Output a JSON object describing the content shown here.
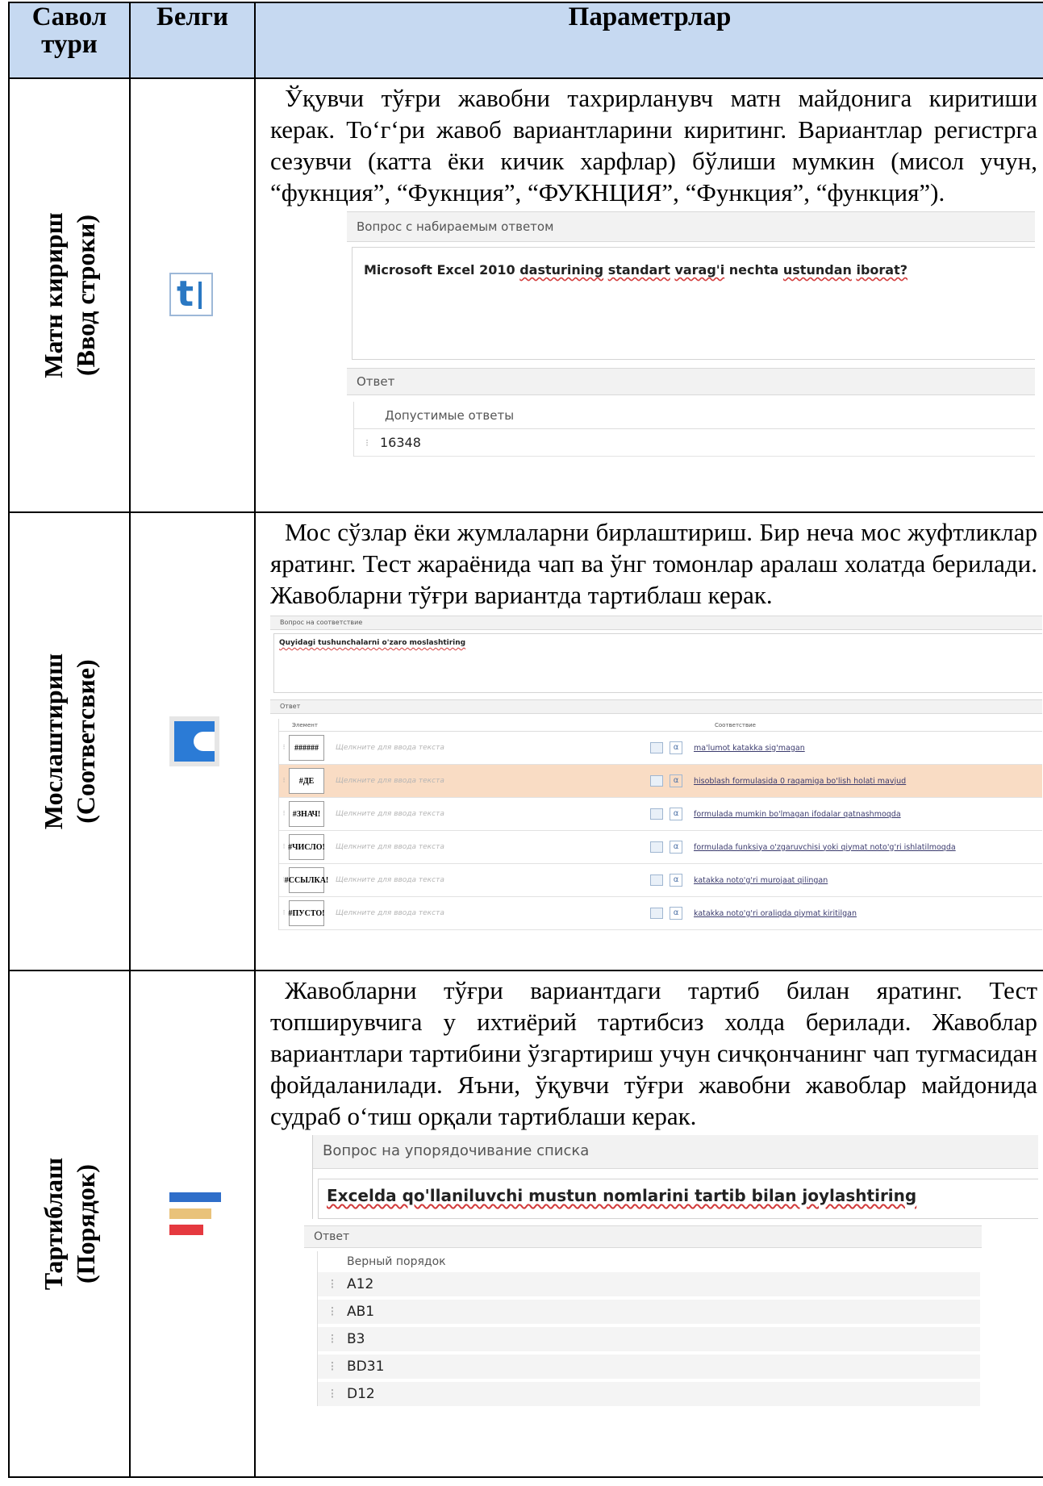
{
  "header": {
    "col1": "Савол тури",
    "col2": "Белги",
    "col3": "Параметрлар"
  },
  "rows": [
    {
      "type_main": "Матн кирирш",
      "type_sub": "(Ввод строки)",
      "icon": "text-input-icon",
      "description": "Ўқувчи тўғри жавобни тахрирланувч матн майдонига киритиши керак. То‘г‘ри жавоб вариантларини киритинг. Вариантлар регистрга сезувчи (катта ёки кичик харфлар) бўлиши мумкин (мисол учун, “фукнция”, “Фукнция”, “ФУКНЦИЯ”, “Функция”, “функция”).",
      "screenshot": {
        "panel_title": "Вопрос с набираемым ответом",
        "question_prefix": "Microsoft Excel 2010 ",
        "question_w1": "dasturining",
        "question_w2": "standart",
        "question_w3": "varag'i",
        "question_mid": " nechta ",
        "question_w4": "ustundan",
        "question_w5": "iborat?",
        "answer_title": "Ответ",
        "column_header": "Допустимые ответы",
        "answer_value": "16348"
      }
    },
    {
      "type_main": "Мослаштириш",
      "type_sub": "(Соответсвие)",
      "icon": "matching-icon",
      "description": "Мос сўзлар ёки жумлаларни бирлаштириш. Бир неча мос жуфтликлар яратинг. Тест жараёнида чап ва ўнг томонлар аралаш холатда берилади. Жавобларни тўғри вариантда тартиблаш керак.",
      "screenshot": {
        "panel_title": "Вопрос на соответствие",
        "question": "Quyidagi tushunchalarni o'zaro moslashtiring",
        "answer_title": "Ответ",
        "col_element": "Элемент",
        "col_match": "Соответствие",
        "placeholder": "Щелкните для ввода текста",
        "alpha_glyph": "α",
        "pairs": [
          {
            "element": "######",
            "answer": "ma'lumot katakka sig'magan"
          },
          {
            "element": "#ДЕ",
            "answer": "hisoblash formulasida 0 raqamiga bo'lish holati mavjud"
          },
          {
            "element": "#ЗНАЧ!",
            "answer": "formulada  mumkin bo'lmagan ifodalar qatnashmoqda"
          },
          {
            "element": "#ЧИСЛО!",
            "answer": "formulada funksiya o'zgaruvchisi yoki qiymat noto'g'ri ishlatilmoqda"
          },
          {
            "element": "#ССЫЛКА!",
            "answer": "katakka noto'g'ri murojaat qilingan"
          },
          {
            "element": "#ПУСТО!",
            "answer": "katakka noto'g'ri oraliqda qiymat kiritilgan"
          }
        ]
      }
    },
    {
      "type_main": "Тартиблаш",
      "type_sub": "(Порядок)",
      "icon": "ordering-icon",
      "description": "Жавобларни тўғри вариантдаги тартиб билан яратинг. Тест топширувчига у ихтиёрий тартибсиз холда берилади. Жавоблар вариантлари тартибини ўзгартириш учун сичқончанинг чап тугмасидан фойдаланилади. Яъни, ўқувчи тўғри жавобни жавоблар майдонида судраб о‘тиш орқали тартиблаши керак.",
      "screenshot": {
        "panel_title": "Вопрос на упорядочивание списка",
        "question": "Excelda qo'llaniluvchi mustun nomlarini tartib bilan joylashtiring",
        "answer_title": "Ответ",
        "column_header": "Верный порядок",
        "items": [
          "A12",
          "AB1",
          "B3",
          "BD31",
          "D12"
        ]
      }
    }
  ],
  "colors": {
    "header_bg": "#c6d9f1",
    "text_icon_blue": "#2a78c3",
    "matching_blue": "#2b7bd6",
    "order_blue": "#2f6ec9",
    "order_yellow": "#e9c27a",
    "order_red": "#e5393f"
  }
}
